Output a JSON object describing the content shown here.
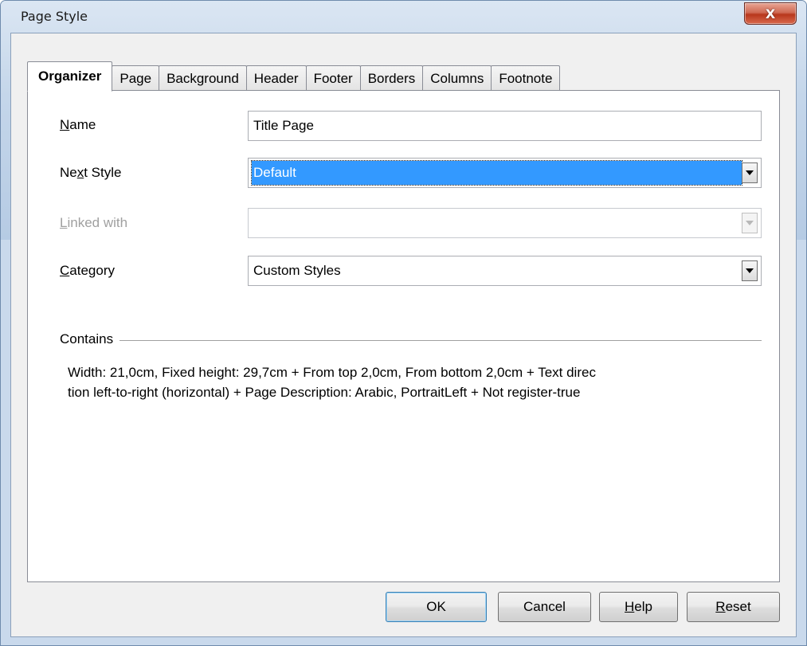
{
  "window": {
    "title": "Page Style",
    "close_label": "X"
  },
  "tabs": [
    {
      "label": "Organizer",
      "active": true
    },
    {
      "label": "Page"
    },
    {
      "label": "Background"
    },
    {
      "label": "Header"
    },
    {
      "label": "Footer"
    },
    {
      "label": "Borders"
    },
    {
      "label": "Columns"
    },
    {
      "label": "Footnote"
    }
  ],
  "organizer": {
    "name": {
      "label_mnemonic": "N",
      "label_rest": "ame",
      "value": "Title Page"
    },
    "next_style": {
      "label_pre": "Ne",
      "label_mnemonic": "x",
      "label_rest": "t Style",
      "value": "Default"
    },
    "linked_with": {
      "label_mnemonic": "L",
      "label_rest": "inked with",
      "value": "",
      "disabled": true
    },
    "category": {
      "label_mnemonic": "C",
      "label_rest": "ategory",
      "value": "Custom Styles"
    },
    "contains": {
      "label": "Contains",
      "line1": "Width: 21,0cm, Fixed height: 29,7cm + From top 2,0cm, From bottom 2,0cm + Text direc",
      "line2": "tion left-to-right (horizontal) + Page Description: Arabic, PortraitLeft + Not register-true"
    }
  },
  "buttons": {
    "ok": "OK",
    "cancel": "Cancel",
    "help_mnemonic": "H",
    "help_rest": "elp",
    "reset_mnemonic": "R",
    "reset_rest": "eset"
  },
  "colors": {
    "selection": "#3399ff",
    "close_button": "#c8452a"
  }
}
